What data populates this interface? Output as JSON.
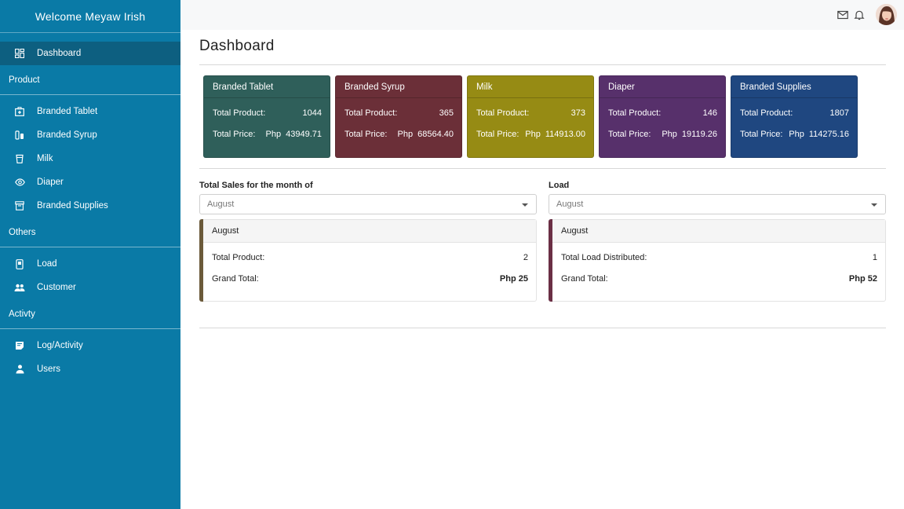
{
  "sidebar": {
    "welcome": "Welcome  Meyaw Irish",
    "dashboard": "Dashboard",
    "sections": {
      "product": "Product",
      "others": "Others",
      "activity": "Activty"
    },
    "product_items": [
      {
        "label": "Branded Tablet",
        "icon": "medkit-icon"
      },
      {
        "label": "Branded Syrup",
        "icon": "bottle-icon"
      },
      {
        "label": "Milk",
        "icon": "can-icon"
      },
      {
        "label": "Diaper",
        "icon": "eye-icon"
      },
      {
        "label": "Branded Supplies",
        "icon": "archive-icon"
      }
    ],
    "others_items": [
      {
        "label": "Load",
        "icon": "phone-icon"
      },
      {
        "label": "Customer",
        "icon": "people-icon"
      }
    ],
    "activity_items": [
      {
        "label": "Log/Activity",
        "icon": "note-icon"
      },
      {
        "label": "Users",
        "icon": "person-icon"
      }
    ],
    "bg_color": "#0a7aa6",
    "active_color": "#0d5f80"
  },
  "main": {
    "title": "Dashboard",
    "cards": [
      {
        "name": "Branded Tablet",
        "total_product_label": "Total Product:",
        "total_product": "1044",
        "total_price_label": "Total Price:",
        "currency": "Php",
        "total_price": "43949.71",
        "color": "#2f5f5a"
      },
      {
        "name": "Branded Syrup",
        "total_product_label": "Total Product:",
        "total_product": "365",
        "total_price_label": "Total Price:",
        "currency": "Php",
        "total_price": "68564.40",
        "color": "#6b2f38"
      },
      {
        "name": "Milk",
        "total_product_label": "Total Product:",
        "total_product": "373",
        "total_price_label": "Total Price:",
        "currency": "Php",
        "total_price": "114913.00",
        "color": "#968b14"
      },
      {
        "name": "Diaper",
        "total_product_label": "Total Product:",
        "total_product": "146",
        "total_price_label": "Total Price:",
        "currency": "Php",
        "total_price": "19119.26",
        "color": "#57306b"
      },
      {
        "name": "Branded Supplies",
        "total_product_label": "Total Product:",
        "total_product": "1807",
        "total_price_label": "Total Price:",
        "currency": "Php",
        "total_price": "114275.16",
        "color": "#1f4780"
      }
    ],
    "sales": {
      "label": "Total Sales for the month of",
      "selected_month": "August",
      "panel_title": "August",
      "total_product_label": "Total Product:",
      "total_product": "2",
      "grand_total_label": "Grand Total:",
      "grand_total": "Php 25",
      "accent": "#6b5a3a"
    },
    "load": {
      "label": "Load",
      "selected_month": "August",
      "panel_title": "August",
      "distributed_label": "Total Load Distributed:",
      "distributed": "1",
      "grand_total_label": "Grand Total:",
      "grand_total": "Php 52",
      "accent": "#6b2f45"
    }
  },
  "topbar": {
    "icons": [
      "mail-icon",
      "bell-icon",
      "avatar"
    ]
  }
}
